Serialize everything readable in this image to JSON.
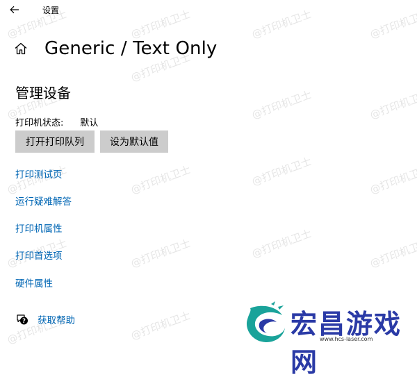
{
  "window": {
    "title": "设置"
  },
  "header": {
    "title": "Generic / Text Only"
  },
  "section": {
    "title": "管理设备"
  },
  "status": {
    "label": "打印机状态:",
    "value": "默认"
  },
  "buttons": {
    "open_queue": "打开打印队列",
    "set_default": "设为默认值"
  },
  "links": [
    {
      "label": "打印测试页"
    },
    {
      "label": "运行疑难解答"
    },
    {
      "label": "打印机属性"
    },
    {
      "label": "打印首选项"
    },
    {
      "label": "硬件属性"
    }
  ],
  "help": {
    "label": "获取帮助"
  },
  "watermark": {
    "text": "@打印机卫士"
  },
  "brand": {
    "name": "宏昌游戏网",
    "url": "www.hcs-laser.com"
  },
  "colors": {
    "link": "#0066b4",
    "button_bg": "#cccccc",
    "brand": "#2a3aa6"
  }
}
